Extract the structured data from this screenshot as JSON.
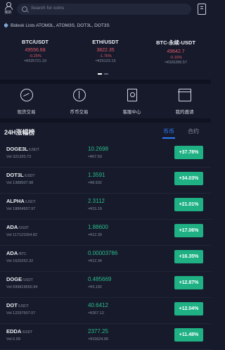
{
  "header": {
    "me_label": "我的",
    "search_placeholder": "Search for coins"
  },
  "notice": {
    "text": "Bidesk Lists ATOM3L, ATOM3S, DOT3L, DOT3S"
  },
  "tickers": [
    {
      "pair": "BTC/USDT",
      "price": "49556.68",
      "change": "-0.25%",
      "cny": "≈¥325721.19"
    },
    {
      "pair": "ETH/USDT",
      "price": "3822.35",
      "change": "-1.76%",
      "cny": "≈¥25123.15"
    },
    {
      "pair": "BTC-永续-USDT",
      "price": "49642.7",
      "change": "-0.16%",
      "cny": "≈¥326286.57"
    }
  ],
  "menu": [
    {
      "label": "现货交易",
      "icon": "spot-trading-icon"
    },
    {
      "label": "币币交易",
      "icon": "coin-trading-icon"
    },
    {
      "label": "客服中心",
      "icon": "customer-service-icon"
    },
    {
      "label": "我的邀请",
      "icon": "invite-gift-icon"
    }
  ],
  "list": {
    "title": "24H涨幅榜",
    "tabs": [
      "币币",
      "合约"
    ],
    "active_tab": "币币",
    "rows": [
      {
        "base": "DOGE3L",
        "quote": "/USDT",
        "vol": "Vol  321320.73",
        "price": "10.2698",
        "cny": "≈¥67.50",
        "change": "+37.78%"
      },
      {
        "base": "DOT3L",
        "quote": "/USDT",
        "vol": "Vol  1388507.98",
        "price": "1.3591",
        "cny": "≈¥8.932",
        "change": "+34.03%"
      },
      {
        "base": "ALPHA",
        "quote": "/USDT",
        "vol": "Vol  18864937.97",
        "price": "2.3112",
        "cny": "≈¥15.19",
        "change": "+21.01%"
      },
      {
        "base": "ADA",
        "quote": "/USDT",
        "vol": "Vol  117121554.82",
        "price": "1.88600",
        "cny": "≈¥12.39",
        "change": "+17.06%"
      },
      {
        "base": "ADA",
        "quote": "/BTC",
        "vol": "Vol  1620252.32",
        "price": "0.00003786",
        "cny": "≈¥12.34",
        "change": "+16.35%"
      },
      {
        "base": "DOGE",
        "quote": "/USDT",
        "vol": "Vol  699819650.94",
        "price": "0.485669",
        "cny": "≈¥3.192",
        "change": "+12.87%"
      },
      {
        "base": "DOT",
        "quote": "/USDT",
        "vol": "Vol  12297507.07",
        "price": "40.6412",
        "cny": "≈¥267.12",
        "change": "+12.04%"
      },
      {
        "base": "EDDA",
        "quote": "/USDT",
        "vol": "Vol  0.09",
        "price": "2377.25",
        "cny": "≈¥15624.95",
        "change": "+11.48%"
      }
    ]
  },
  "colors": {
    "background": "#161a2b",
    "up": "#2dbd8b",
    "down": "#e05a6a",
    "accent": "#2f7cf6",
    "badge": "#1fb184"
  }
}
